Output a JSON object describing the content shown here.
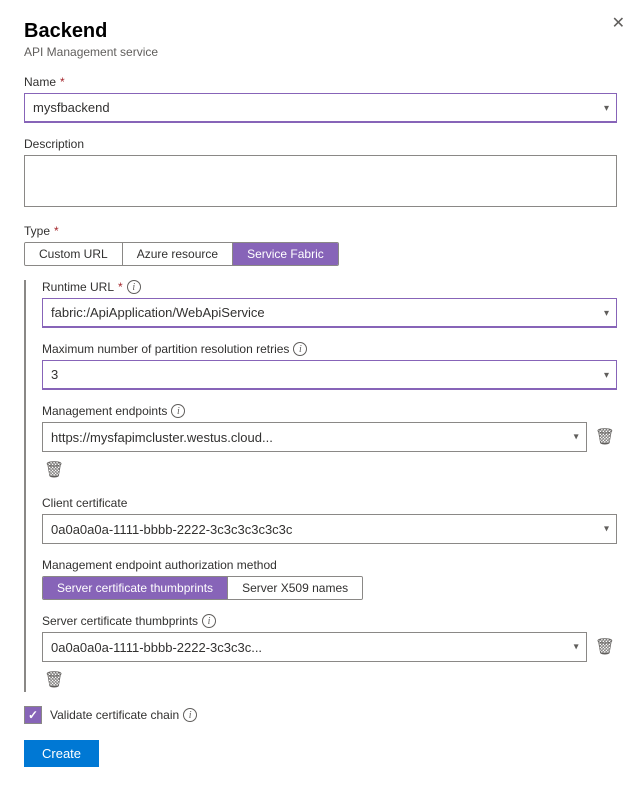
{
  "panel": {
    "title": "Backend",
    "subtitle": "API Management service",
    "close_label": "×"
  },
  "name_field": {
    "label": "Name",
    "required": "*",
    "value": "mysfbackend"
  },
  "description_field": {
    "label": "Description",
    "value": ""
  },
  "type_field": {
    "label": "Type",
    "required": "*",
    "options": [
      "Custom URL",
      "Azure resource",
      "Service Fabric"
    ],
    "active": "Service Fabric"
  },
  "runtime_url_field": {
    "label": "Runtime URL",
    "required": "*",
    "value": "fabric:/ApiApplication/WebApiService",
    "info": true
  },
  "max_partition_field": {
    "label": "Maximum number of partition resolution retries",
    "value": "3",
    "info": true
  },
  "management_endpoints_field": {
    "label": "Management endpoints",
    "info": true,
    "endpoint_value": "https://mysfapimcluster.westus.cloud...",
    "add_icon": "+"
  },
  "client_cert_field": {
    "label": "Client certificate",
    "value": "0a0a0a0a-1111-bbbb-2222-3c3c3c3c3c3c",
    "options": [
      "0a0a0a0a-1111-bbbb-2222-3c3c3c3c3c3c"
    ]
  },
  "auth_method_field": {
    "label": "Management endpoint authorization method",
    "options": [
      "Server certificate thumbprints",
      "Server X509 names"
    ],
    "active": "Server certificate thumbprints"
  },
  "server_thumbprints_field": {
    "label": "Server certificate thumbprints",
    "info": true,
    "value": "0a0a0a0a-1111-bbbb-2222-3c3c3c..."
  },
  "validate_cert_field": {
    "label": "Validate certificate chain",
    "info": true,
    "checked": true
  },
  "create_button": {
    "label": "Create"
  },
  "icons": {
    "chevron_down": "▾",
    "delete": "🗑",
    "close": "✕",
    "check": "✓",
    "info": "i",
    "plus": "+"
  }
}
